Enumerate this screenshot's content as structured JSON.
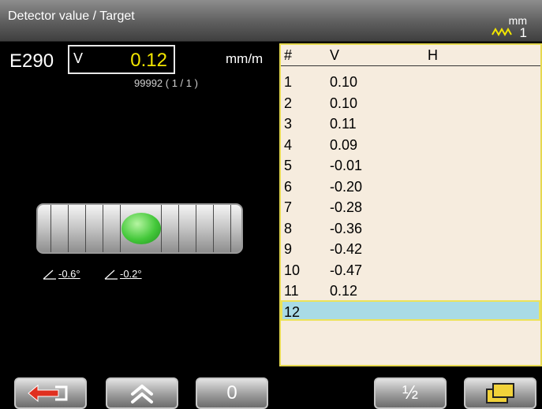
{
  "header": {
    "title": "Detector value / Target",
    "unit_label": "mm",
    "resolution_value": "1"
  },
  "measurement": {
    "sensor": "E290",
    "axis": "V",
    "value": "0.12",
    "unit": "mm/m",
    "serial": "99992 ( 1 / 1 )"
  },
  "level": {
    "angle_left": "-0.6°",
    "angle_right": "-0.2°"
  },
  "table": {
    "headers": [
      "#",
      "V",
      "H"
    ],
    "rows": [
      {
        "index": "1",
        "v": "0.10",
        "h": ""
      },
      {
        "index": "2",
        "v": "0.10",
        "h": ""
      },
      {
        "index": "3",
        "v": "0.11",
        "h": ""
      },
      {
        "index": "4",
        "v": "0.09",
        "h": ""
      },
      {
        "index": "5",
        "v": "-0.01",
        "h": ""
      },
      {
        "index": "6",
        "v": "-0.20",
        "h": ""
      },
      {
        "index": "7",
        "v": "-0.28",
        "h": ""
      },
      {
        "index": "8",
        "v": "-0.36",
        "h": ""
      },
      {
        "index": "9",
        "v": "-0.42",
        "h": ""
      },
      {
        "index": "10",
        "v": "-0.47",
        "h": ""
      },
      {
        "index": "11",
        "v": "0.12",
        "h": ""
      },
      {
        "index": "12",
        "v": "",
        "h": ""
      }
    ],
    "selected_row": "12"
  },
  "toolbar": {
    "back_icon": "back-arrow-icon",
    "up_icon": "double-chevron-up-icon",
    "zero_label": "0",
    "half_label": "½",
    "windows_icon": "windows-icon"
  },
  "colors": {
    "value_yellow": "#f2e600",
    "table_bg": "#f6ecde",
    "selected_row": "#a9dbe6",
    "bubble_green": "#44c83a",
    "back_arrow_red": "#e03020"
  }
}
